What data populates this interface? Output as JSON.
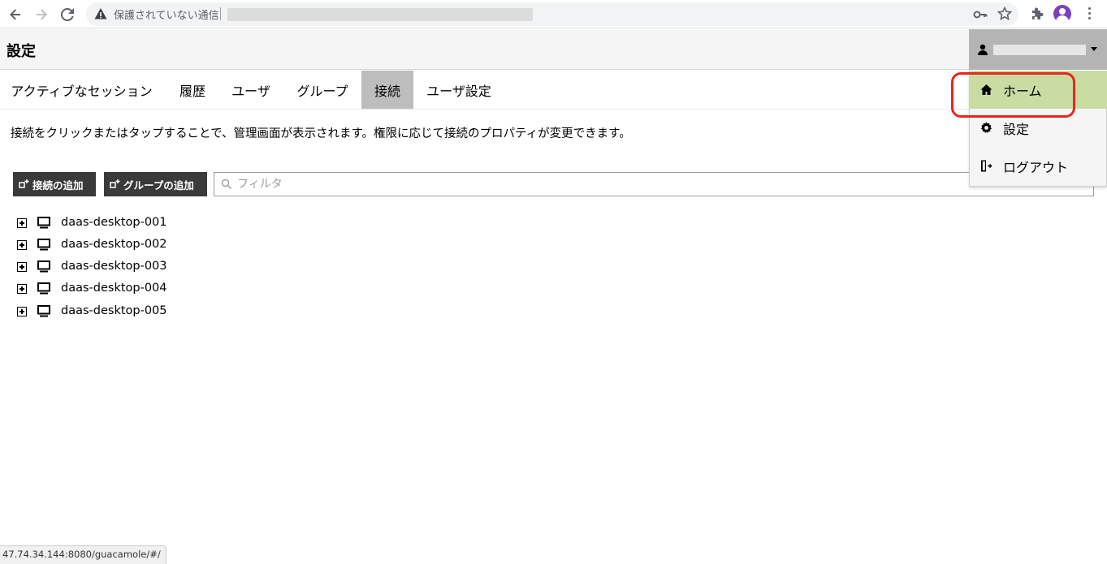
{
  "browser": {
    "security_text": "保護されていない通信",
    "status_url": "47.74.34.144:8080/guacamole/#/"
  },
  "header": {
    "title": "設定"
  },
  "tabs": [
    {
      "label": "アクティブなセッション",
      "active": false
    },
    {
      "label": "履歴",
      "active": false
    },
    {
      "label": "ユーザ",
      "active": false
    },
    {
      "label": "グループ",
      "active": false
    },
    {
      "label": "接続",
      "active": true
    },
    {
      "label": "ユーザ設定",
      "active": false
    }
  ],
  "main": {
    "description": "接続をクリックまたはタップすることで、管理画面が表示されます。権限に応じて接続のプロパティが変更できます。",
    "add_connection_label": "接続の追加",
    "add_group_label": "グループの追加",
    "filter_placeholder": "フィルタ",
    "connections": [
      {
        "name": "daas-desktop-001"
      },
      {
        "name": "daas-desktop-002"
      },
      {
        "name": "daas-desktop-003"
      },
      {
        "name": "daas-desktop-004"
      },
      {
        "name": "daas-desktop-005"
      }
    ]
  },
  "user_menu": {
    "items": [
      {
        "label": "ホーム",
        "icon": "home-icon",
        "highlighted": true
      },
      {
        "label": "設定",
        "icon": "gear-icon",
        "highlighted": false
      },
      {
        "label": "ログアウト",
        "icon": "logout-icon",
        "highlighted": false
      }
    ]
  },
  "colors": {
    "active_tab": "#bdbdbd",
    "menu_highlight": "#c9dca1",
    "button_bg": "#3a3a3a",
    "annotation": "#e8261c"
  }
}
